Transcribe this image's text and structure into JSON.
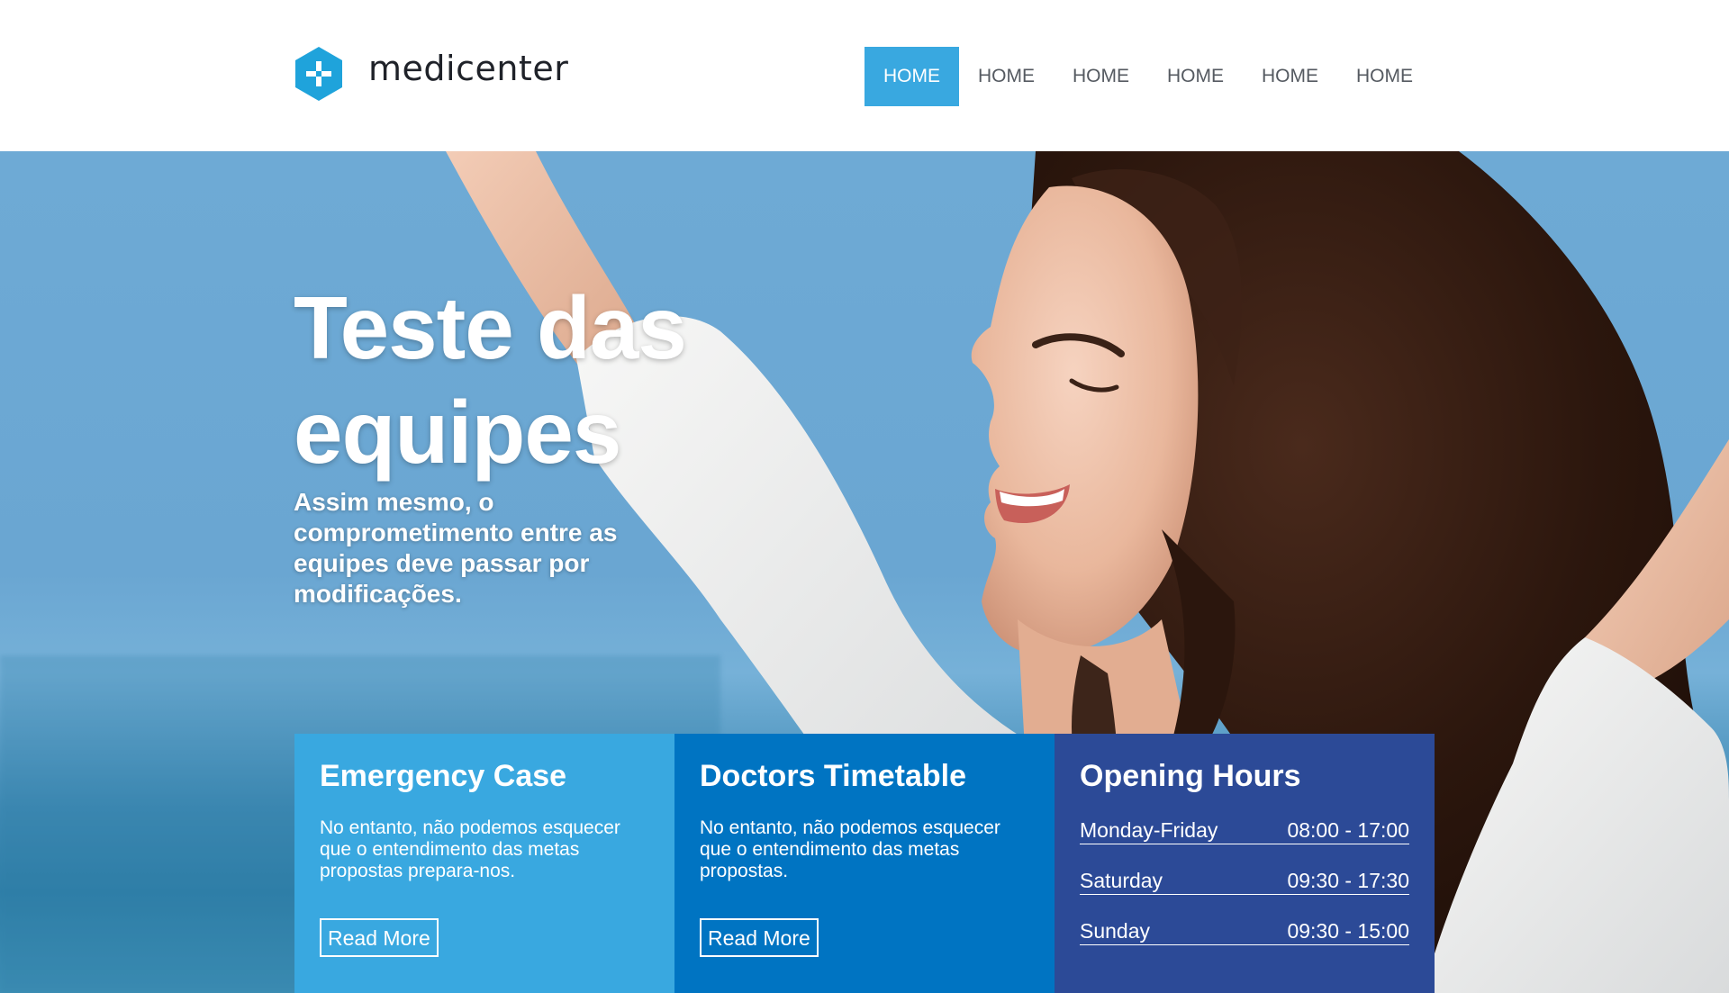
{
  "header": {
    "logo_text": "medicenter",
    "nav": [
      {
        "label": "HOME",
        "active": true
      },
      {
        "label": "HOME",
        "active": false
      },
      {
        "label": "HOME",
        "active": false
      },
      {
        "label": "HOME",
        "active": false
      },
      {
        "label": "HOME",
        "active": false
      },
      {
        "label": "HOME",
        "active": false
      }
    ]
  },
  "hero": {
    "title": "Teste das equipes",
    "subtitle": "Assim mesmo, o comprometimento entre as equipes deve passar por modificações."
  },
  "boxes": {
    "emergency": {
      "title": "Emergency Case",
      "text": "No entanto, não podemos esquecer que o entendimento das metas propostas prepara-nos.",
      "button": "Read More"
    },
    "doctors": {
      "title": "Doctors Timetable",
      "text": "No entanto, não podemos esquecer que o entendimento das metas propostas.",
      "button": "Read More"
    },
    "hours": {
      "title": "Opening Hours",
      "rows": [
        {
          "day": "Monday-Friday",
          "time": "08:00 - 17:00"
        },
        {
          "day": "Saturday",
          "time": "09:30 - 17:30"
        },
        {
          "day": "Sunday",
          "time": "09:30 - 15:00"
        }
      ]
    }
  },
  "colors": {
    "accent": "#39a8e0",
    "box_emergency": "#39a8e0",
    "box_doctors": "#0074c2",
    "box_hours": "#2c4a97",
    "logo": "#1fa3db"
  },
  "icons": {
    "logo": "hexagon-plus-icon"
  }
}
